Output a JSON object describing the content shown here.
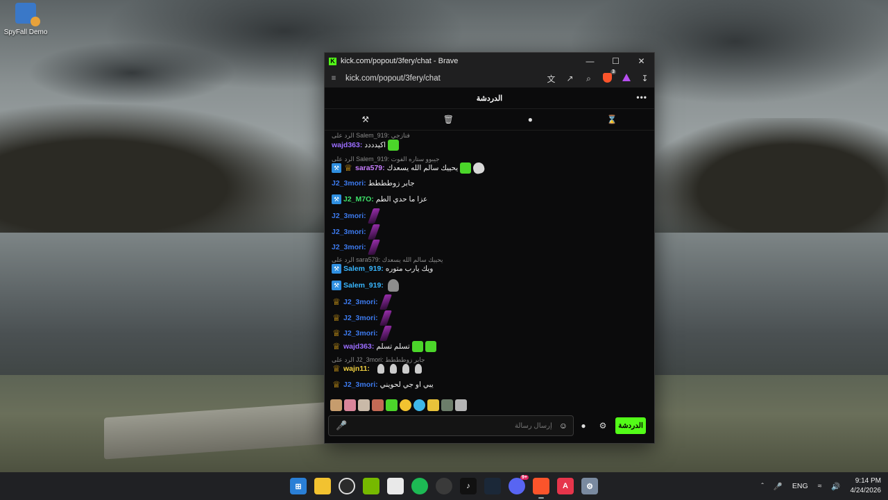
{
  "desktop": {
    "icon_label": "SpyFall Demo"
  },
  "browser": {
    "title": "kick.com/popout/3fery/chat - Brave",
    "url": "kick.com/popout/3fery/chat",
    "shield_count": "3"
  },
  "chat": {
    "header": "الدردشة",
    "input_placeholder": "إرسال رسالة",
    "send_label": "الدردشة",
    "messages": [
      {
        "reply": "الرد على Salem_919: فتازجي",
        "user": "wajd363:",
        "text": "اكيدددد",
        "color": "#9b6dff"
      },
      {
        "reply": "الرد على Salem_919: جيبوو ستاره الفوت",
        "user": "sara579:",
        "text": "يحييك سالم الله يسعدك",
        "color": "#c77dff"
      },
      {
        "user": "J2_3mori:",
        "text": "جابر زوطططط",
        "color": "#3d7bf0"
      },
      {
        "user": "J2_M7O:",
        "text": "عزا ما حدي الطم",
        "color": "#3ee06a"
      },
      {
        "user": "J2_3mori:",
        "text": "",
        "color": "#3d7bf0"
      },
      {
        "user": "J2_3mori:",
        "text": "",
        "color": "#3d7bf0"
      },
      {
        "user": "J2_3mori:",
        "text": "",
        "color": "#3d7bf0"
      },
      {
        "reply": "الرد على sara579: يحييك سالم الله يسعدك",
        "user": "Salem_919:",
        "text": "ويك يارب متوره",
        "color": "#38b6ff"
      },
      {
        "user": "Salem_919:",
        "text": "",
        "color": "#38b6ff"
      },
      {
        "user": "J2_3mori:",
        "text": "",
        "color": "#3d7bf0"
      },
      {
        "user": "J2_3mori:",
        "text": "",
        "color": "#3d7bf0"
      },
      {
        "user": "J2_3mori:",
        "text": "",
        "color": "#3d7bf0"
      },
      {
        "user": "wajd363:",
        "text": "تسلم تسلم",
        "color": "#9b6dff"
      },
      {
        "reply": "الرد على J2_3mori: جابر زوطططط",
        "user": "wajn11:",
        "text": "",
        "color": "#f0d040"
      },
      {
        "user": "J2_3mori:",
        "text": "يبي او جي لحويني",
        "color": "#3d7bf0"
      }
    ]
  },
  "taskbar": {
    "language": "ENG",
    "time": "9:14 PM",
    "date": "4/24/2026",
    "discord_badge": "9+"
  }
}
